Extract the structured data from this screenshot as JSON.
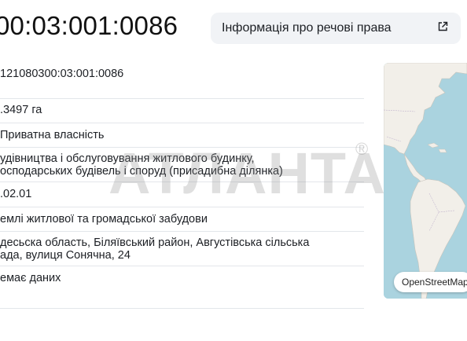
{
  "cadastral_number_heading": "00:03:001:0086",
  "rights_button": {
    "label": "Інформація про речові права",
    "icon": "external-link-icon"
  },
  "details": [
    {
      "lines": [
        "121080300:03:001:0086"
      ]
    },
    {
      "lines": [
        ".3497 га"
      ]
    },
    {
      "lines": [
        "Приватна власність"
      ]
    },
    {
      "lines": [
        "удівництва і обслуговування житлового будинку,",
        "осподарських будівель і споруд (присадибна ділянка)"
      ]
    },
    {
      "lines": [
        ".02.01"
      ]
    },
    {
      "lines": [
        "емлі житлової та громадської забудови"
      ]
    },
    {
      "lines": [
        "десьска область, Біляївський район, Августівська сільська",
        "ада, вулиця Сонячна, 24"
      ]
    },
    {
      "lines": [
        "емає даних"
      ]
    }
  ],
  "watermark": {
    "text": "АТЛАНТА",
    "mark": "®"
  },
  "map": {
    "attribution": "OpenStreetMap",
    "water_color": "#aad3df",
    "land_color": "#f2efe9"
  }
}
